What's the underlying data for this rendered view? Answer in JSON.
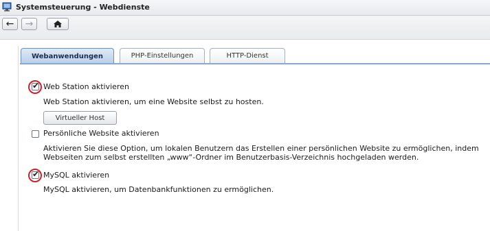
{
  "window": {
    "title": "Systemsteuerung - Webdienste",
    "icon": "control-panel-icon"
  },
  "toolbar": {
    "back_icon": "←",
    "forward_icon": "→",
    "home_icon": "⌂"
  },
  "tabs": [
    {
      "label": "Webanwendungen",
      "active": true
    },
    {
      "label": "PHP-Einstellungen",
      "active": false
    },
    {
      "label": "HTTP-Dienst",
      "active": false
    }
  ],
  "options": {
    "web_station": {
      "label": "Web Station aktivieren",
      "checked": true,
      "description": "Web Station aktivieren, um eine Website selbst zu hosten.",
      "button": "Virtueller Host"
    },
    "personal_website": {
      "label": "Persönliche Website aktivieren",
      "checked": false,
      "description_line1": "Aktivieren Sie diese Option, um lokalen Benutzern das Erstellen einer persönlichen Website zu ermöglichen, indem",
      "description_line2": "Webseiten zum selbst erstellten „www“-Ordner im Benutzerbasis-Verzeichnis hochgeladen werden."
    },
    "mysql": {
      "label": "MySQL aktivieren",
      "checked": true,
      "description": "MySQL aktivieren, um Datenbankfunktionen zu ermöglichen."
    }
  },
  "colors": {
    "highlight_circle": "#d2202a",
    "active_tab": "#b9cfea"
  }
}
